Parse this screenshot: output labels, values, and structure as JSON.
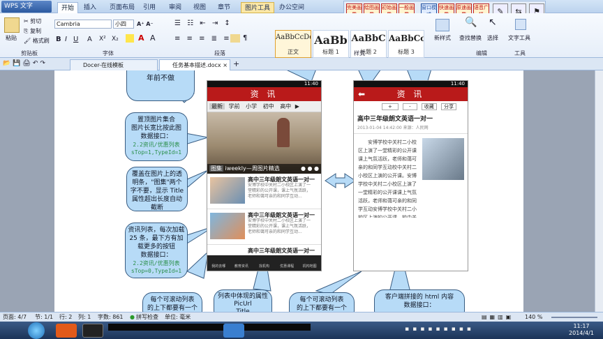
{
  "app": {
    "name": "WPS 文字"
  },
  "ribbon_tabs": [
    "开始",
    "插入",
    "页面布局",
    "引用",
    "审阅",
    "视图",
    "章节",
    "图片工具",
    "办公空间"
  ],
  "plugins": [
    "完美画质",
    "绘图画质",
    "初始画质",
    "一般画质",
    "窗口模式",
    "快速画质",
    "原速画质",
    "语音广播"
  ],
  "ribbon": {
    "paste": "粘贴",
    "cut": "剪切",
    "copy": "复制",
    "format_painter": "格式刷",
    "font_name": "Cambria",
    "font_size": "小四",
    "styles": [
      {
        "sample": "AaBbCcDd",
        "name": "正文"
      },
      {
        "sample": "AaBb",
        "name": "标题 1"
      },
      {
        "sample": "AaBbC",
        "name": "标题 2"
      },
      {
        "sample": "AaBbCc",
        "name": "标题 3"
      }
    ],
    "new_style": "新样式",
    "find_replace": "查找替换",
    "select": "选择",
    "text_tools": "文字工具",
    "groups": {
      "clipboard": "剪贴板",
      "font": "字体",
      "paragraph": "段落",
      "style": "样式",
      "edit": "编辑",
      "tools": "工具"
    }
  },
  "doc_tabs": [
    "Docer-在线模板",
    "任务基本描述.docx"
  ],
  "callouts": {
    "c1": "年前不做",
    "c2_text": "置顶图片集合\n图片长宽比按此图\n数据接口：",
    "c2_code": "2.2资讯/优惠列表\nsTop=1,TypeId=1",
    "c3": "覆盖在图片上的透明条，\"图集\"两个字不要，显示 Title 属性超出长度自动截断",
    "c4_text": "资讯列表，每次加载25 条，最下方有加载更多的按钮\n数据接口：",
    "c4_code": "2.2资讯/优惠列表\nsTop=0,TypeId=1",
    "c5": "每个可滚动列表\n的上下都要有一个",
    "c6": "列表中体现的属性\nPicUrl\nTitle",
    "c7": "每个可滚动列表\n的上下都要有一个",
    "c8": "客户端拼接的 html 内容\n数据接口："
  },
  "phone1": {
    "status_time": "11:40",
    "title": "资 讯",
    "categories": [
      "最新",
      "学前",
      "小学",
      "初中",
      "高中"
    ],
    "banner_tag": "图集",
    "banner_caption": "iweekly—周图片精选",
    "news": [
      {
        "title": "高中三年级朗文英语一对一",
        "desc": "安博学校中关村二小校区上演了一堂精彩的公开课，课上气氛活跃，老师和蔼可亲的和同学互动..."
      },
      {
        "title": "高中三年级朗文英语一对一",
        "desc": "安博学校中关村二小校区上演了一堂精彩的公开课，课上气氛活跃，老师和蔼可亲的和同学互动..."
      },
      {
        "title": "高中三年级朗文英语一对一",
        "desc": ""
      }
    ],
    "nav": [
      "我的去哪",
      "教育资讯",
      "找机构",
      "优惠课程",
      "机构地图"
    ]
  },
  "phone2": {
    "status_time": "11:40",
    "title": "资 讯",
    "actions": [
      "+",
      "-",
      "收藏",
      "分享"
    ],
    "article_title": "高中三年级朗文英语一对一",
    "meta": "2013-01-04    14:42:00    来源：人民网",
    "body": "安博学校中关村二小校区上演了一堂精彩的公开课课上气氛活跃，老师和蔼可亲的和同学互动校中关村二小校区上演的公开课。安博学校中关村二小校区上演了一堂精彩的公开课课上气氛活跃，老师和蔼可亲的和同学互动安博学校中关村二小校区上演的公开课。校中关村二小校区上演了一堂精彩的公开课课上气氛活跃，校中关村二小校区上演了一堂精彩的公开课课上气氛活跃，老师和蔼可亲的和同学互动校中关村二小校区上演了一堂精彩的公开课课上气氛活跃。"
  },
  "statusbar": {
    "page": "页面: 4/7",
    "section": "节: 1/1",
    "row": "行: 2",
    "col": "列: 1",
    "words": "字数: 861",
    "spell": "拼写检查",
    "unit": "单位: 毫米",
    "zoom": "140 %"
  },
  "taskbar": {
    "time": "11:17",
    "date": "2014/4/1"
  },
  "colors": {
    "accent": "#b91a1a",
    "callout": "#b7dbf7"
  }
}
